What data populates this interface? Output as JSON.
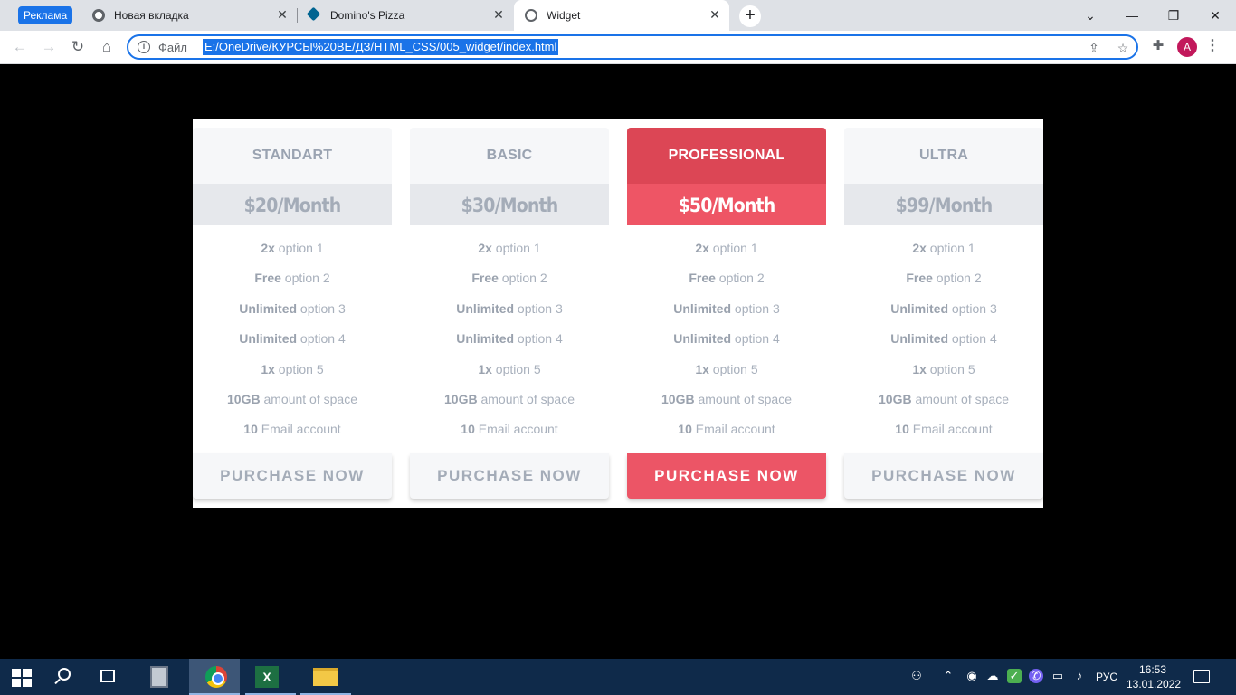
{
  "browser": {
    "ad_badge": "Реклама",
    "tabs": [
      {
        "title": "Новая вкладка"
      },
      {
        "title": "Domino's Pizza"
      },
      {
        "title": "Widget"
      }
    ],
    "address_scheme": "Файл",
    "url": "E:/OneDrive/КУРСЫ%20BE/ДЗ/HTML_CSS/005_widget/index.html",
    "profile_initial": "A"
  },
  "widget": {
    "featured_color": "#dc4655",
    "plans": [
      {
        "name": "STANDART",
        "price": "$20/Month",
        "button": "PURCHASE NOW",
        "features": [
          {
            "strong": "2x",
            "text": " option 1"
          },
          {
            "strong": "Free",
            "text": " option 2"
          },
          {
            "strong": "Unlimited",
            "text": " option 3"
          },
          {
            "strong": "Unlimited",
            "text": " option 4"
          },
          {
            "strong": "1x",
            "text": " option 5"
          },
          {
            "strong": "10GB",
            "text": " amount of space"
          },
          {
            "strong": "10",
            "text": " Email account"
          }
        ]
      },
      {
        "name": "BASIC",
        "price": "$30/Month",
        "button": "PURCHASE NOW",
        "features": [
          {
            "strong": "2x",
            "text": " option 1"
          },
          {
            "strong": "Free",
            "text": " option 2"
          },
          {
            "strong": "Unlimited",
            "text": " option 3"
          },
          {
            "strong": "Unlimited",
            "text": " option 4"
          },
          {
            "strong": "1x",
            "text": " option 5"
          },
          {
            "strong": "10GB",
            "text": " amount of space"
          },
          {
            "strong": "10",
            "text": " Email account"
          }
        ]
      },
      {
        "name": "PROFESSIONAL",
        "price": "$50/Month",
        "button": "PURCHASE NOW",
        "features": [
          {
            "strong": "2x",
            "text": " option 1"
          },
          {
            "strong": "Free",
            "text": " option 2"
          },
          {
            "strong": "Unlimited",
            "text": " option 3"
          },
          {
            "strong": "Unlimited",
            "text": " option 4"
          },
          {
            "strong": "1x",
            "text": " option 5"
          },
          {
            "strong": "10GB",
            "text": " amount of space"
          },
          {
            "strong": "10",
            "text": " Email account"
          }
        ]
      },
      {
        "name": "ULTRA",
        "price": "$99/Month",
        "button": "PURCHASE NOW",
        "features": [
          {
            "strong": "2x",
            "text": " option 1"
          },
          {
            "strong": "Free",
            "text": " option 2"
          },
          {
            "strong": "Unlimited",
            "text": " option 3"
          },
          {
            "strong": "Unlimited",
            "text": " option 4"
          },
          {
            "strong": "1x",
            "text": " option 5"
          },
          {
            "strong": "10GB",
            "text": " amount of space"
          },
          {
            "strong": "10",
            "text": " Email account"
          }
        ]
      }
    ]
  },
  "taskbar": {
    "excel_letter": "X",
    "language": "РУС",
    "time": "16:53",
    "date": "13.01.2022"
  }
}
